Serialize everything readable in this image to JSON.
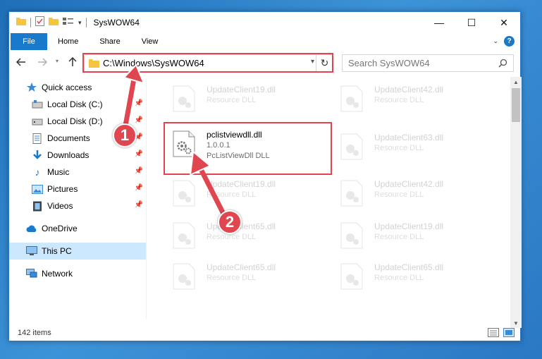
{
  "window": {
    "title": "SysWOW64",
    "controls": {
      "minimize": "—",
      "maximize": "☐",
      "close": "✕"
    }
  },
  "ribbon": {
    "tabs": [
      "File",
      "Home",
      "Share",
      "View"
    ],
    "help": "?"
  },
  "address": {
    "path": "C:\\Windows\\SysWOW64",
    "search_placeholder": "Search SysWOW64"
  },
  "nav": {
    "items": [
      {
        "label": "Quick access",
        "icon": "star-icon",
        "pinned": false
      },
      {
        "label": "Local Disk (C:)",
        "icon": "drive-icon",
        "pinned": true
      },
      {
        "label": "Local Disk (D:)",
        "icon": "drive-icon",
        "pinned": true
      },
      {
        "label": "Documents",
        "icon": "documents-icon",
        "pinned": true
      },
      {
        "label": "Downloads",
        "icon": "download-icon",
        "pinned": true
      },
      {
        "label": "Music",
        "icon": "music-icon",
        "pinned": true
      },
      {
        "label": "Pictures",
        "icon": "pictures-icon",
        "pinned": true
      },
      {
        "label": "Videos",
        "icon": "videos-icon",
        "pinned": true
      },
      {
        "label": "OneDrive",
        "icon": "cloud-icon",
        "pinned": false
      },
      {
        "label": "This PC",
        "icon": "computer-icon",
        "pinned": false,
        "selected": true
      },
      {
        "label": "Network",
        "icon": "network-icon",
        "pinned": false
      }
    ]
  },
  "files": {
    "selected": {
      "name": "pclistviewdll.dll",
      "version": "1.0.0.1",
      "desc": "PcListViewDll DLL"
    },
    "left": [
      {
        "name": "UpdateClient19.dll",
        "desc": "Resource DLL"
      },
      {
        "name": "UpdateClient19.dll",
        "desc": "Resource DLL"
      },
      {
        "name": "UpdateClient65.dll",
        "desc": "Resource DLL"
      },
      {
        "name": "UpdateClient65.dll",
        "desc": "Resource DLL"
      }
    ],
    "right": [
      {
        "name": "UpdateClient42.dll",
        "desc": "Resource DLL"
      },
      {
        "name": "UpdateClient63.dll",
        "desc": "Resource DLL"
      },
      {
        "name": "UpdateClient42.dll",
        "desc": "Resource DLL"
      },
      {
        "name": "UpdateClient19.dll",
        "desc": "Resource DLL"
      },
      {
        "name": "UpdateClient65.dll",
        "desc": "Resource DLL"
      }
    ]
  },
  "status": {
    "item_count": "142 items"
  },
  "annotations": {
    "step1": "1",
    "step2": "2",
    "color": "#e0464f"
  }
}
